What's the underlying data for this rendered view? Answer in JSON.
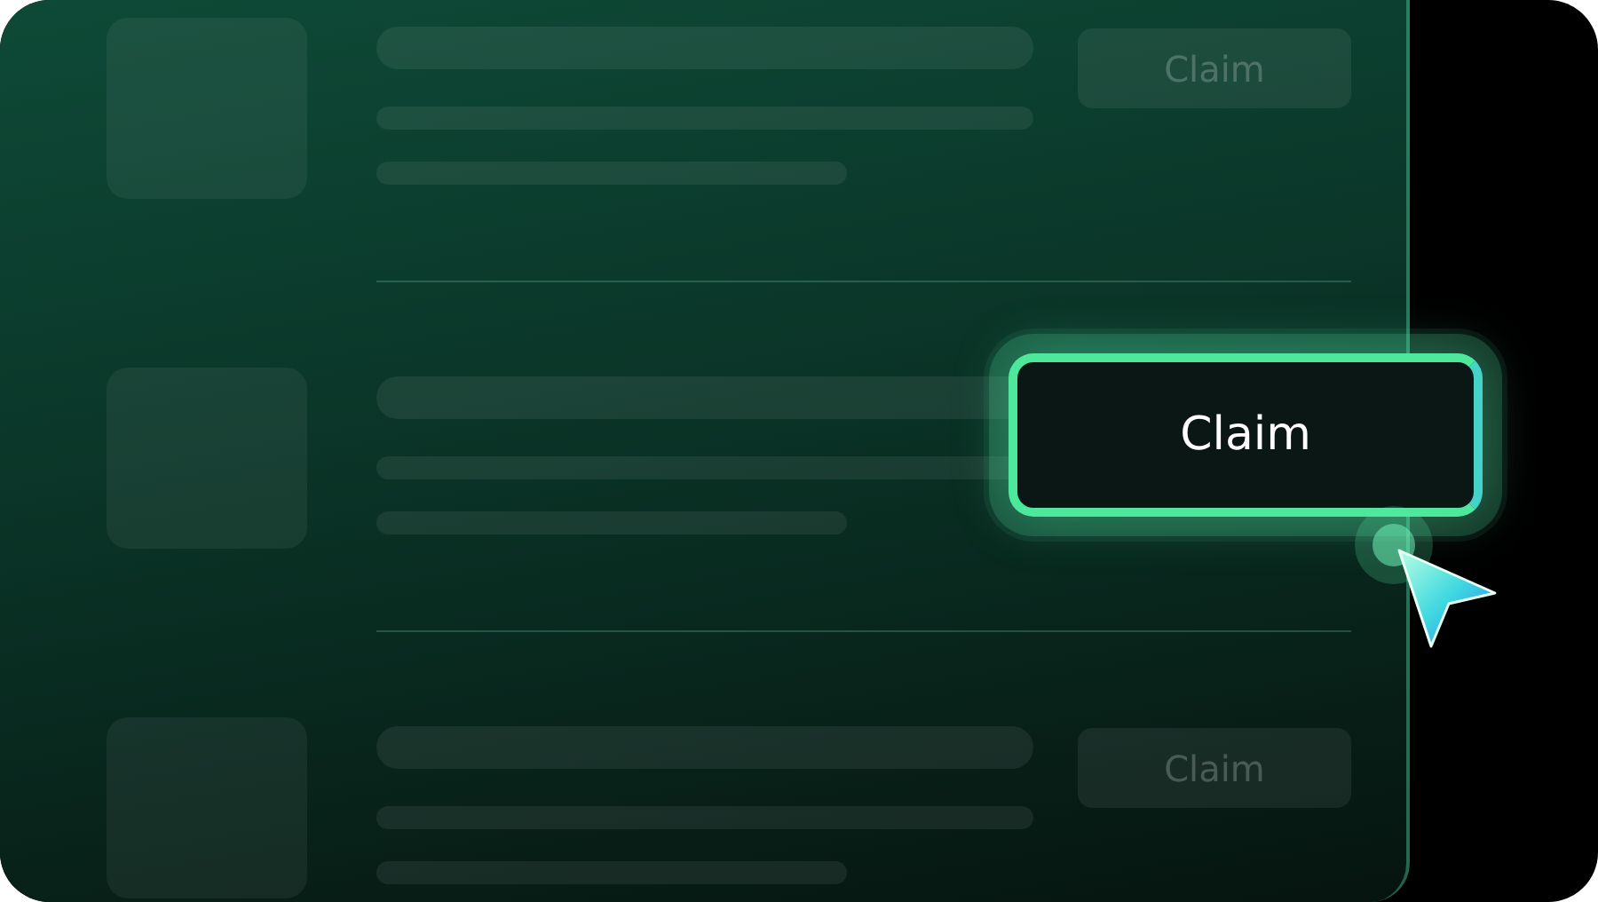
{
  "rows": [
    {
      "button": {
        "label": "Claim",
        "highlighted": false
      }
    },
    {
      "button": {
        "label": "Claim",
        "highlighted": true
      }
    },
    {
      "button": {
        "label": "Claim",
        "highlighted": false
      }
    }
  ]
}
